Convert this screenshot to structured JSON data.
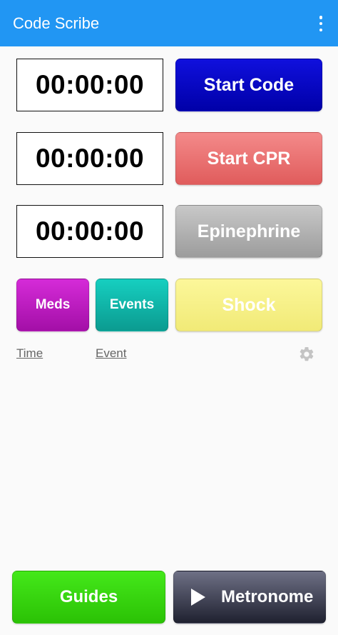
{
  "appbar": {
    "title": "Code Scribe",
    "menu_icon": "more-vert-icon"
  },
  "timers": {
    "code": "00:00:00",
    "cpr": "00:00:00",
    "epi": "00:00:00"
  },
  "buttons": {
    "start_code": "Start Code",
    "start_cpr": "Start CPR",
    "epinephrine": "Epinephrine",
    "meds": "Meds",
    "events": "Events",
    "shock": "Shock",
    "guides": "Guides",
    "metronome": "Metronome"
  },
  "log": {
    "time_header": "Time",
    "event_header": "Event",
    "settings_icon": "gear-icon"
  },
  "colors": {
    "appbar": "#2196f3",
    "start_code": "#0000c8",
    "start_cpr": "#ec7373",
    "epinephrine": "#b0b0b0",
    "shock": "#f7f184",
    "meds": "#bd1dc0",
    "events": "#12b8aa",
    "guides": "#38d60f",
    "metronome": "#3a3c4e"
  }
}
